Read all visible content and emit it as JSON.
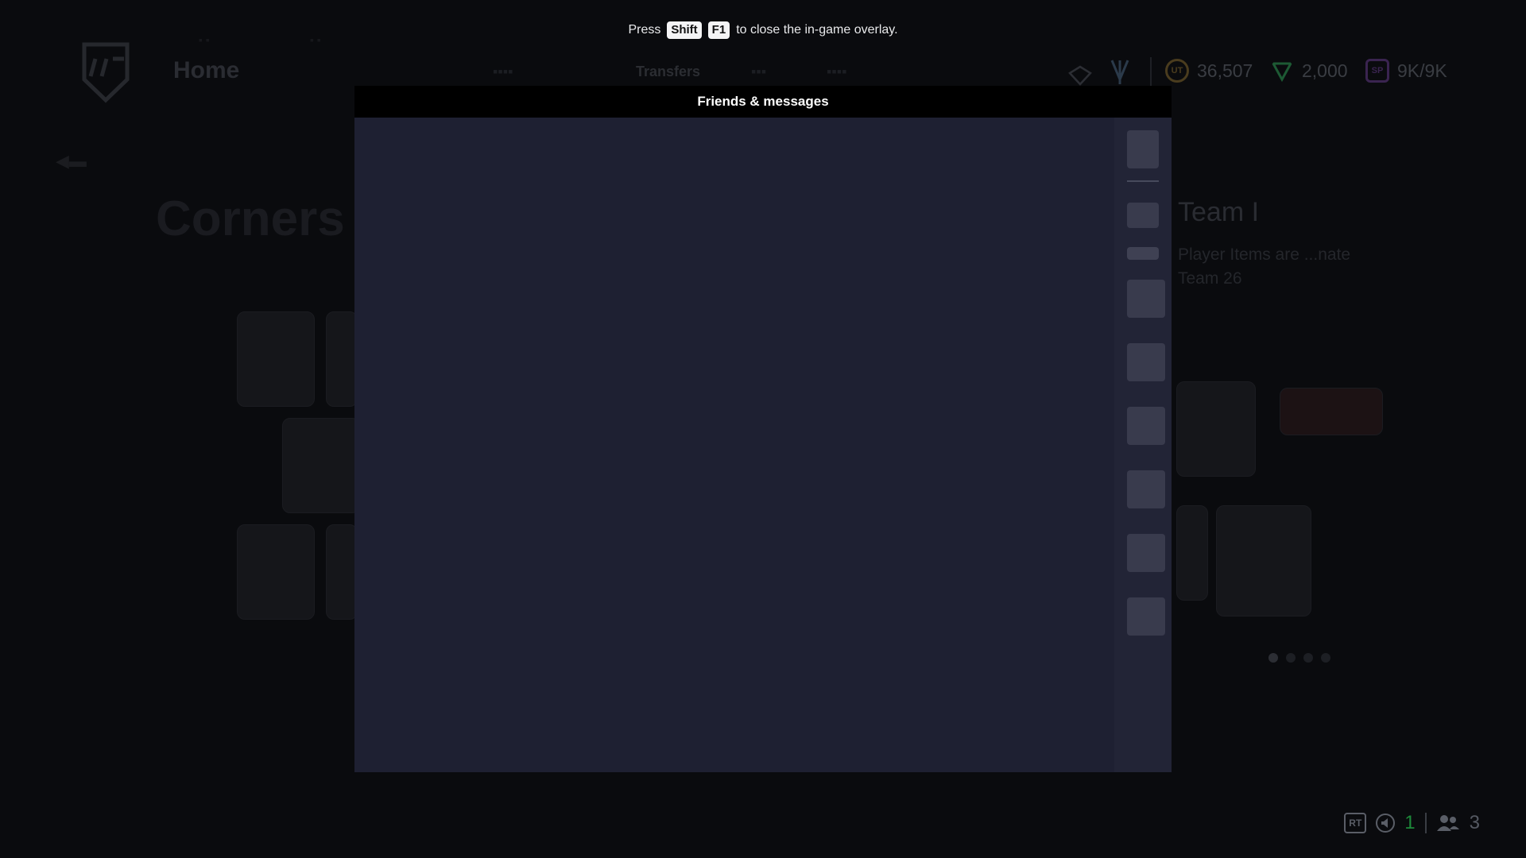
{
  "overlay": {
    "hint_before": "Press",
    "key_1": "Shift",
    "key_2": "F1",
    "hint_after": "to close the in-game overlay.",
    "panel_title": "Friends & messages"
  },
  "background": {
    "home_label": "Home",
    "nav_active": "Transfers",
    "context_title": "Corners",
    "promo_title": "Team I",
    "promo_desc": "Player Items are ...nate Team 26",
    "currency": [
      {
        "icon": "coins-icon",
        "value": "36,507",
        "color": "#c8a24a"
      },
      {
        "icon": "points-icon",
        "value": "2,000",
        "color": "#2ecc71"
      },
      {
        "icon": "sp-icon",
        "value": "9K/9K",
        "color": "#8e44ad"
      }
    ]
  },
  "status_bar": {
    "rt_label": "RT",
    "online_count": "1",
    "party_count": "3"
  },
  "colors": {
    "panel": "#1e2032",
    "rail": "#222436",
    "rail_button": "#393b4d",
    "header": "#000000"
  }
}
